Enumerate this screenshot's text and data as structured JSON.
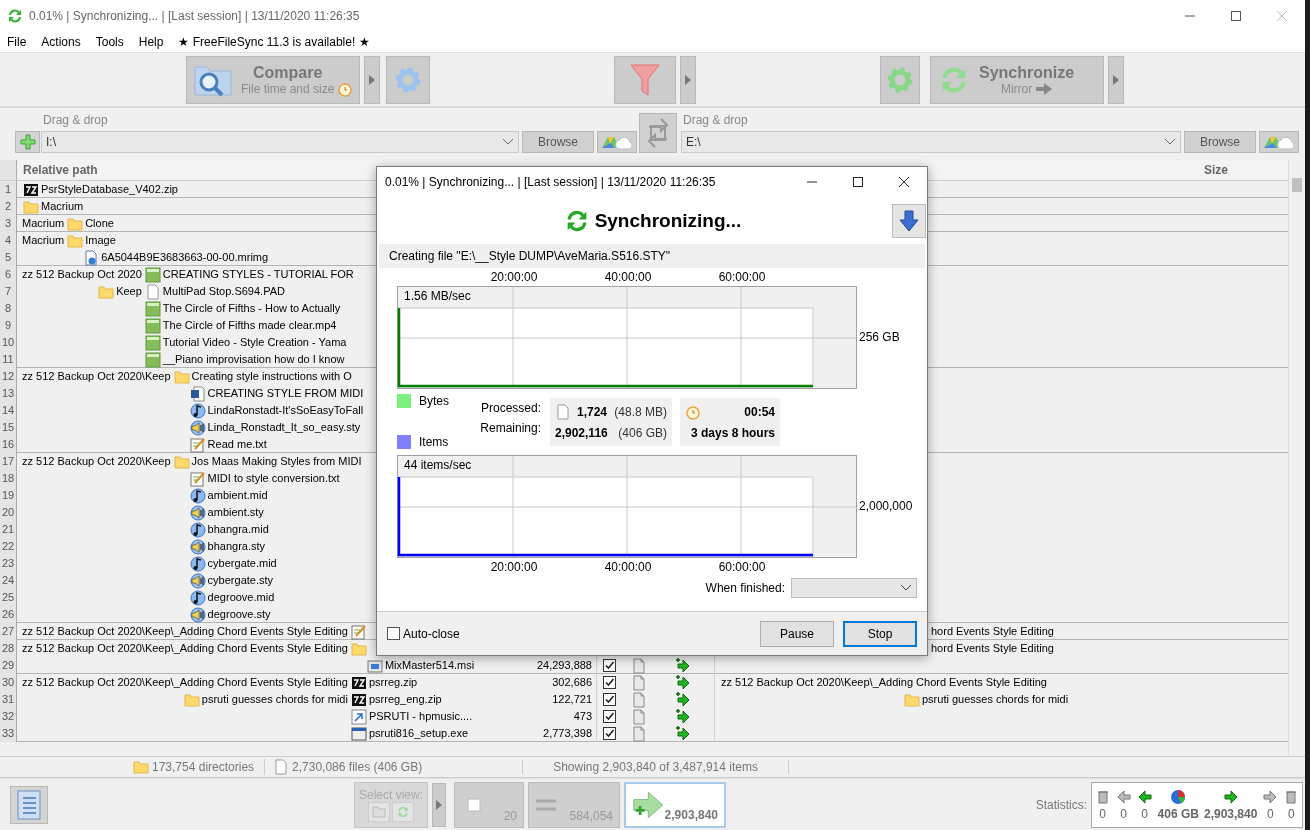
{
  "window": {
    "title": "0.01% | Synchronizing... | [Last session] | 13/11/2020 11:26:35"
  },
  "menu": [
    "File",
    "Actions",
    "Tools",
    "Help",
    "★ FreeFileSync 11.3 is available! ★"
  ],
  "toolbar": {
    "compare": {
      "label": "Compare",
      "sublabel": "File time and size",
      "disabled": true
    },
    "synchronize": {
      "label": "Synchronize",
      "sublabel": "Mirror",
      "disabled": true
    }
  },
  "folders": [
    {
      "hint": "Drag & drop",
      "path": "I:\\",
      "browse": "Browse"
    },
    {
      "hint": "Drag & drop",
      "path": "E:\\",
      "browse": "Browse"
    }
  ],
  "table": {
    "columns": [
      "Relative path",
      "Size"
    ],
    "groups": [
      {
        "rows": [
          {
            "num": "1",
            "item": {
              "kind": "archive",
              "name": "PsrStyleDatabase_V402.zip"
            }
          }
        ]
      },
      {
        "rows": [
          {
            "num": "2",
            "item": {
              "kind": "folder",
              "name": "Macrium"
            }
          }
        ]
      },
      {
        "parent": "Macrium",
        "rows": [
          {
            "num": "3",
            "item": {
              "kind": "folder",
              "name": "Clone"
            }
          }
        ]
      },
      {
        "parent": "Macrium",
        "rows": [
          {
            "num": "4",
            "item": {
              "kind": "folder",
              "name": "Image"
            },
            "children": [
              {
                "num": "5",
                "item": {
                  "kind": "disk",
                  "name": "6A5044B9E3683663-00-00.mrimg"
                }
              }
            ]
          }
        ]
      },
      {
        "parent": "zz 512 Backup Oct 2020",
        "rows": [
          {
            "num": "6",
            "item": {
              "kind": "video",
              "name": "CREATING STYLES - TUTORIAL FOR"
            }
          },
          {
            "num": "7",
            "side_folder": "Keep",
            "item": {
              "kind": "document",
              "name": "MultiPad Stop.S694.PAD"
            }
          },
          {
            "num": "8",
            "item": {
              "kind": "video",
              "name": "The Circle of Fifths - How to Actually"
            }
          },
          {
            "num": "9",
            "item": {
              "kind": "video",
              "name": "The Circle of Fifths made clear.mp4"
            }
          },
          {
            "num": "10",
            "item": {
              "kind": "video",
              "name": "Tutorial Video - Style Creation - Yama"
            }
          },
          {
            "num": "11",
            "item": {
              "kind": "video",
              "name": "__Piano improvisation how do I know"
            }
          }
        ]
      },
      {
        "parent": "zz 512 Backup Oct 2020\\Keep",
        "rows": [
          {
            "num": "12",
            "item": {
              "kind": "folder",
              "name": "Creating style instructions with O"
            },
            "children": [
              {
                "num": "13",
                "item": {
                  "kind": "word",
                  "name": "CREATING STYLE FROM MIDI"
                }
              },
              {
                "num": "14",
                "item": {
                  "kind": "music",
                  "name": "LindaRonstadt-It'sSoEasyToFall"
                }
              },
              {
                "num": "15",
                "item": {
                  "kind": "speaker",
                  "name": "Linda_Ronstadt_It_so_easy.sty"
                }
              },
              {
                "num": "16",
                "item": {
                  "kind": "notepad",
                  "name": "Read me.txt"
                }
              }
            ]
          }
        ]
      },
      {
        "parent": "zz 512 Backup Oct 2020\\Keep",
        "rows": [
          {
            "num": "17",
            "item": {
              "kind": "folder",
              "name": "Jos Maas Making Styles from MIDI"
            },
            "children": [
              {
                "num": "18",
                "item": {
                  "kind": "notepad",
                  "name": "MIDI to style conversion.txt"
                }
              },
              {
                "num": "19",
                "item": {
                  "kind": "music",
                  "name": "ambient.mid"
                }
              },
              {
                "num": "20",
                "item": {
                  "kind": "speaker",
                  "name": "ambient.sty"
                }
              },
              {
                "num": "21",
                "item": {
                  "kind": "music",
                  "name": "bhangra.mid"
                }
              },
              {
                "num": "22",
                "item": {
                  "kind": "speaker",
                  "name": "bhangra.sty"
                }
              },
              {
                "num": "23",
                "item": {
                  "kind": "music",
                  "name": "cybergate.mid"
                }
              },
              {
                "num": "24",
                "item": {
                  "kind": "speaker",
                  "name": "cybergate.sty"
                }
              },
              {
                "num": "25",
                "item": {
                  "kind": "music",
                  "name": "degroove.mid"
                }
              },
              {
                "num": "26",
                "item": {
                  "kind": "speaker",
                  "name": "degroove.sty"
                }
              }
            ]
          }
        ]
      },
      {
        "parent": "zz 512 Backup Oct 2020\\Keep\\_Adding Chord Events Style Editing",
        "rows": [
          {
            "num": "27",
            "item": {
              "kind": "notepad"
            },
            "right_parent": "hord Events Style Editing"
          }
        ]
      },
      {
        "parent": "zz 512 Backup Oct 2020\\Keep\\_Adding Chord Events Style Editing",
        "rows": [
          {
            "num": "28",
            "item": {
              "kind": "folder"
            },
            "right_parent": "hord Events Style Editing",
            "children": [
              {
                "num": "29",
                "item": {
                  "kind": "installer",
                  "name": "MixMaster514.msi"
                },
                "size": "24,293,888",
                "checked": true,
                "category": {
                  "kind": "left_only"
                },
                "action": {
                  "kind": "create_right"
                }
              }
            ]
          }
        ]
      },
      {
        "parent": "zz 512 Backup Oct 2020\\Keep\\_Adding Chord Events Style Editing",
        "rows": [
          {
            "num": "30",
            "item": {
              "kind": "archive",
              "name": "psrreg.zip"
            },
            "size": "302,686",
            "checked": true,
            "category": {
              "kind": "left_only"
            },
            "action": {
              "kind": "create_right"
            },
            "right_parent": "zz 512 Backup Oct 2020\\Keep\\_Adding Chord Events Style Editing"
          },
          {
            "num": "31",
            "side_folder": "psruti guesses chords for midi",
            "item": {
              "kind": "archive",
              "name": "psrreg_eng.zip"
            },
            "size": "122,721",
            "checked": true,
            "category": {
              "kind": "left_only"
            },
            "action": {
              "kind": "create_right"
            },
            "right_folder": "psruti guesses chords for midi"
          },
          {
            "num": "32",
            "item": {
              "kind": "shortcut",
              "name": "PSRUTI - hpmusic...."
            },
            "size": "473",
            "checked": true,
            "category": {
              "kind": "left_only"
            },
            "action": {
              "kind": "create_right"
            }
          },
          {
            "num": "33",
            "item": {
              "kind": "program",
              "name": "psruti816_setup.exe"
            },
            "size": "2,773,398",
            "checked": true,
            "category": {
              "kind": "left_only"
            },
            "action": {
              "kind": "create_right"
            }
          }
        ]
      }
    ]
  },
  "status_bar": {
    "directories": "173,754 directories",
    "files": "2,730,086 files (406 GB)",
    "showing": "Showing 2,903,840 of 3,487,914 items"
  },
  "bottom": {
    "select_view": "Select view:",
    "views": [
      {
        "kind": "none",
        "count": "20",
        "selected": false
      },
      {
        "kind": "equal",
        "count": "584,054",
        "selected": false
      },
      {
        "kind": "create",
        "count": "2,903,840",
        "selected": true
      }
    ],
    "statistics_label": "Statistics:",
    "statistics": [
      {
        "kind": "delete_left",
        "value": "0"
      },
      {
        "kind": "update_left",
        "value": "0"
      },
      {
        "kind": "create_left",
        "value": "0"
      },
      {
        "kind": "data",
        "value": "406 GB"
      },
      {
        "kind": "create_right",
        "value": "2,903,840"
      },
      {
        "kind": "update_right",
        "value": "0"
      },
      {
        "kind": "delete_right",
        "value": "0"
      }
    ]
  },
  "dialog": {
    "title": "0.01% | Synchronizing... | [Last session] | 13/11/2020 11:26:35",
    "heading": "Synchronizing...",
    "status": "Creating file \"E:\\__Style DUMP\\AveMaria.S516.STY\"",
    "ticks_top": [
      "20:00:00",
      "40:00:00",
      "60:00:00"
    ],
    "ticks_bottom": [
      "20:00:00",
      "40:00:00",
      "60:00:00"
    ],
    "graphs": [
      {
        "rate": "1.56 MB/sec",
        "max": "256 GB",
        "color": "#008000"
      },
      {
        "rate": "44 items/sec",
        "max": "2,000,000",
        "color": "#0000ff"
      }
    ],
    "legend": [
      {
        "label": "Bytes",
        "color": "#7cf07c"
      },
      {
        "label": "Items",
        "color": "#8080ff"
      }
    ],
    "stats": [
      {
        "label": "Processed:",
        "count": "1,724",
        "size": "(48.8 MB)",
        "time": "00:54"
      },
      {
        "label": "Remaining:",
        "count": "2,902,116",
        "size": "(406 GB)",
        "time": "3 days 8 hours"
      }
    ],
    "when_finished": "When finished:",
    "auto_close": {
      "label": "Auto-close",
      "checked": false
    },
    "buttons": [
      {
        "label": "Pause",
        "default": false
      },
      {
        "label": "Stop",
        "default": true
      }
    ]
  }
}
